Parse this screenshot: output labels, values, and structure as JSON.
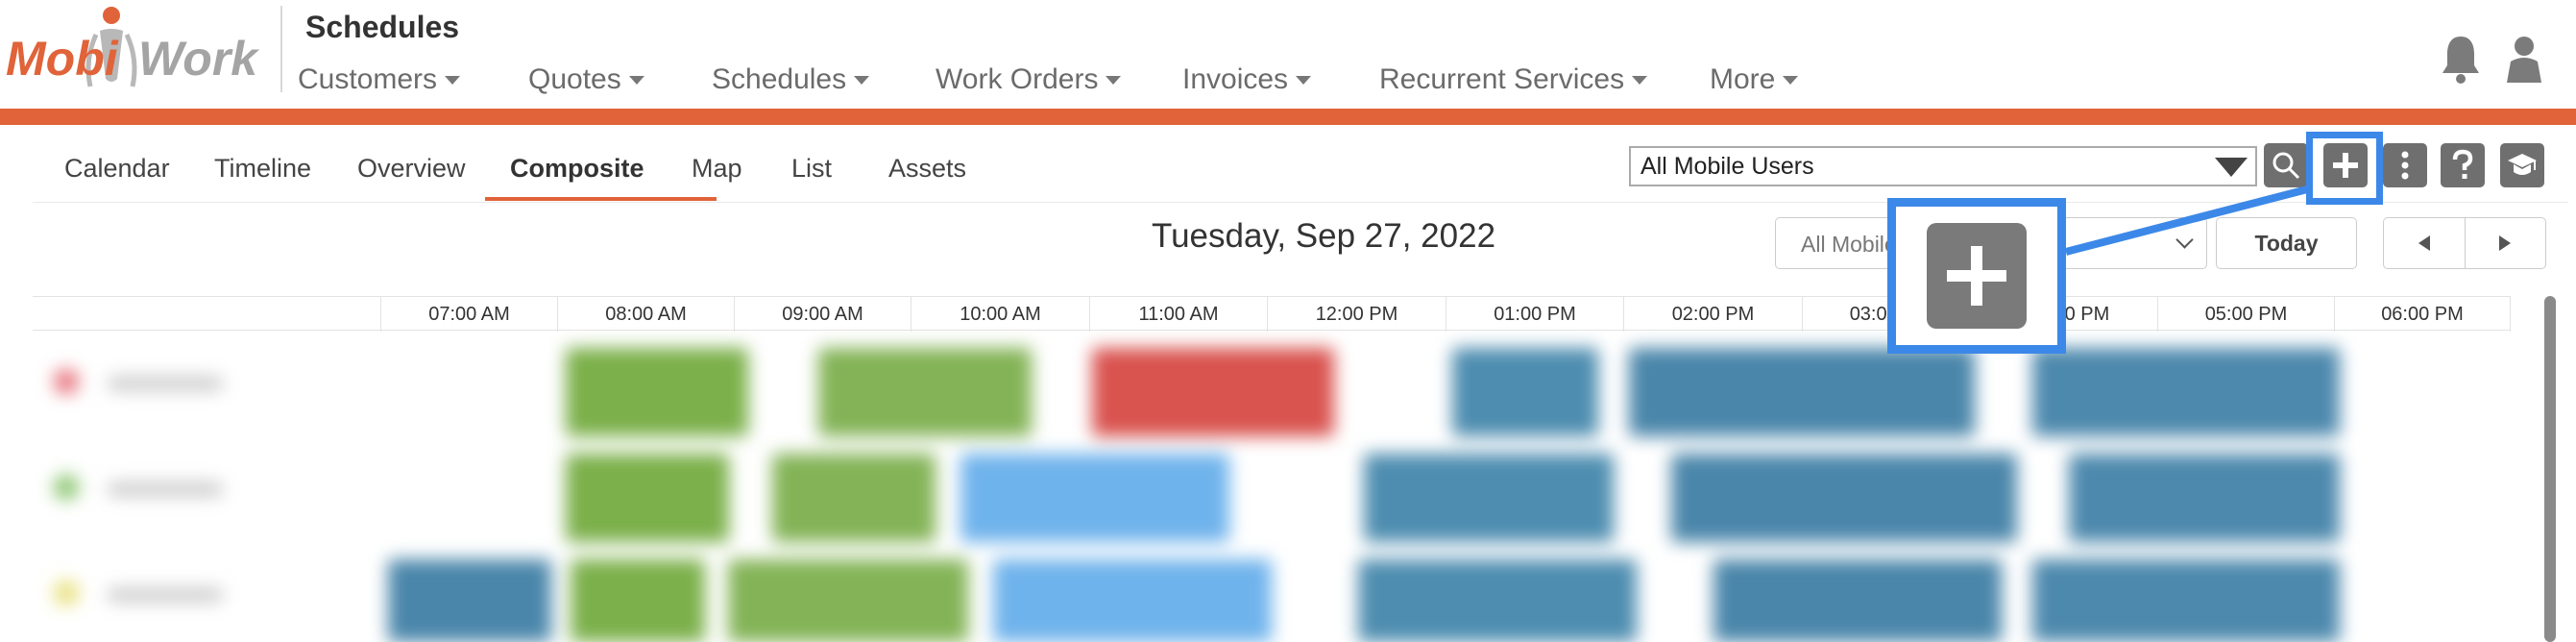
{
  "brand": {
    "logo_text_left": "Mobi",
    "logo_text_right": "Work",
    "accent_color": "#e0633a",
    "highlight_color": "#3c88e8"
  },
  "header": {
    "app_title": "Schedules",
    "nav": [
      {
        "label": "Customers",
        "has_dropdown": true
      },
      {
        "label": "Quotes",
        "has_dropdown": true
      },
      {
        "label": "Schedules",
        "has_dropdown": true
      },
      {
        "label": "Work Orders",
        "has_dropdown": true
      },
      {
        "label": "Invoices",
        "has_dropdown": true
      },
      {
        "label": "Recurrent Services",
        "has_dropdown": true
      },
      {
        "label": "More",
        "has_dropdown": true
      }
    ],
    "icons": [
      "bell-icon",
      "user-icon"
    ]
  },
  "tabs": [
    {
      "label": "Calendar",
      "active": false
    },
    {
      "label": "Timeline",
      "active": false
    },
    {
      "label": "Overview",
      "active": false
    },
    {
      "label": "Composite",
      "active": true
    },
    {
      "label": "Map",
      "active": false
    },
    {
      "label": "List",
      "active": false
    },
    {
      "label": "Assets",
      "active": false
    }
  ],
  "toolbar": {
    "user_select_value": "All Mobile Users",
    "buttons": [
      "search-icon",
      "plus-icon",
      "more-vertical-icon",
      "help-icon",
      "graduation-cap-icon"
    ]
  },
  "schedule": {
    "date_title": "Tuesday, Sep 27, 2022",
    "filter_select_value": "All Mobile",
    "today_label": "Today",
    "hours": [
      "07:00 AM",
      "08:00 AM",
      "09:00 AM",
      "10:00 AM",
      "11:00 AM",
      "12:00 PM",
      "01:00 PM",
      "02:00 PM",
      "03:00 PM",
      "04:00 PM",
      "05:00 PM",
      "06:00 PM"
    ]
  },
  "callout": {
    "target": "add-button",
    "icon": "plus-icon"
  }
}
